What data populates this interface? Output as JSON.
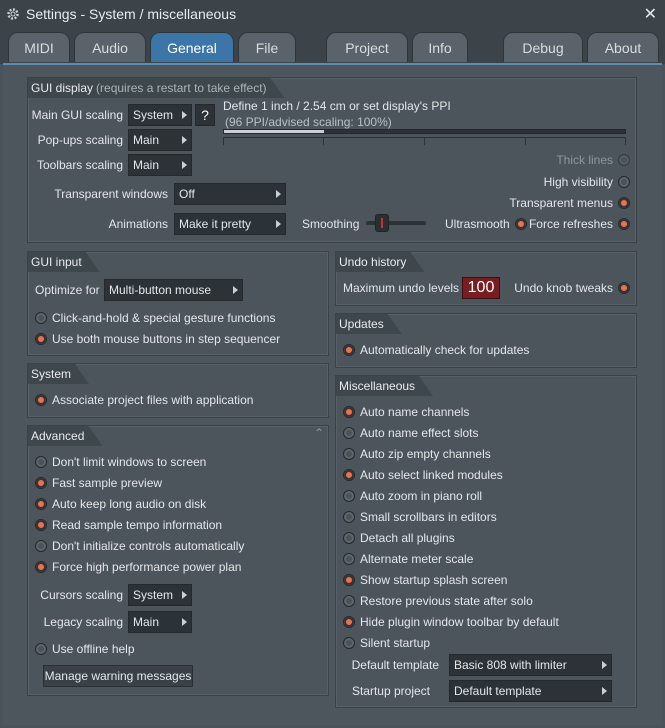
{
  "window": {
    "title": "Settings - System / miscellaneous"
  },
  "tabs": [
    "MIDI",
    "Audio",
    "General",
    "File",
    "Project",
    "Info",
    "Debug",
    "About"
  ],
  "gui_display": {
    "title": "GUI display",
    "subtitle": "(requires a restart to take effect)",
    "main_scaling_label": "Main GUI scaling",
    "main_scaling_value": "System",
    "help_label": "?",
    "popups_label": "Pop-ups scaling",
    "popups_value": "Main",
    "toolbars_label": "Toolbars scaling",
    "toolbars_value": "Main",
    "ppi_label": "Define 1 inch / 2.54 cm or set display's PPI",
    "ppi_info": "(96 PPI/advised scaling: 100%)",
    "ppi_fill": 0.25,
    "transparent_windows_label": "Transparent windows",
    "transparent_windows_value": "Off",
    "animations_label": "Animations",
    "animations_value": "Make it pretty",
    "smoothing_label": "Smoothing",
    "thick_lines": "Thick lines",
    "high_visibility": "High visibility",
    "transparent_menus": "Transparent menus",
    "ultrasmooth": "Ultrasmooth",
    "force_refreshes": "Force refreshes"
  },
  "gui_input": {
    "title": "GUI input",
    "optimize_label": "Optimize for",
    "optimize_value": "Multi-button mouse",
    "click_hold": "Click-and-hold & special gesture functions",
    "both_buttons": "Use both mouse buttons in step sequencer"
  },
  "system": {
    "title": "System",
    "associate": "Associate project files with application"
  },
  "advanced": {
    "title": "Advanced",
    "options": [
      {
        "label": "Don't limit windows to screen",
        "on": false
      },
      {
        "label": "Fast sample preview",
        "on": true
      },
      {
        "label": "Auto keep long audio on disk",
        "on": true
      },
      {
        "label": "Read sample tempo information",
        "on": true
      },
      {
        "label": "Don't initialize controls automatically",
        "on": false
      },
      {
        "label": "Force high performance power plan",
        "on": true
      }
    ],
    "cursors_label": "Cursors scaling",
    "cursors_value": "System",
    "legacy_label": "Legacy scaling",
    "legacy_value": "Main",
    "offline_help": "Use offline help",
    "manage_button": "Manage warning messages"
  },
  "undo": {
    "title": "Undo history",
    "max_label": "Maximum undo levels",
    "max_value": "100",
    "knob_tweaks": "Undo knob tweaks"
  },
  "updates": {
    "title": "Updates",
    "auto_check": "Automatically check for updates"
  },
  "misc": {
    "title": "Miscellaneous",
    "options": [
      {
        "label": "Auto name channels",
        "on": true
      },
      {
        "label": "Auto name effect slots",
        "on": false
      },
      {
        "label": "Auto zip empty channels",
        "on": false
      },
      {
        "label": "Auto select linked modules",
        "on": true
      },
      {
        "label": "Auto zoom in piano roll",
        "on": false
      },
      {
        "label": "Small scrollbars in editors",
        "on": false
      },
      {
        "label": "Detach all plugins",
        "on": false
      },
      {
        "label": "Alternate meter scale",
        "on": false
      },
      {
        "label": "Show startup splash screen",
        "on": true
      },
      {
        "label": "Restore previous state after solo",
        "on": false
      },
      {
        "label": "Hide plugin window toolbar by default",
        "on": true
      },
      {
        "label": "Silent startup",
        "on": false
      }
    ],
    "default_template_label": "Default template",
    "default_template_value": "Basic 808 with limiter",
    "startup_project_label": "Startup project",
    "startup_project_value": "Default template"
  }
}
